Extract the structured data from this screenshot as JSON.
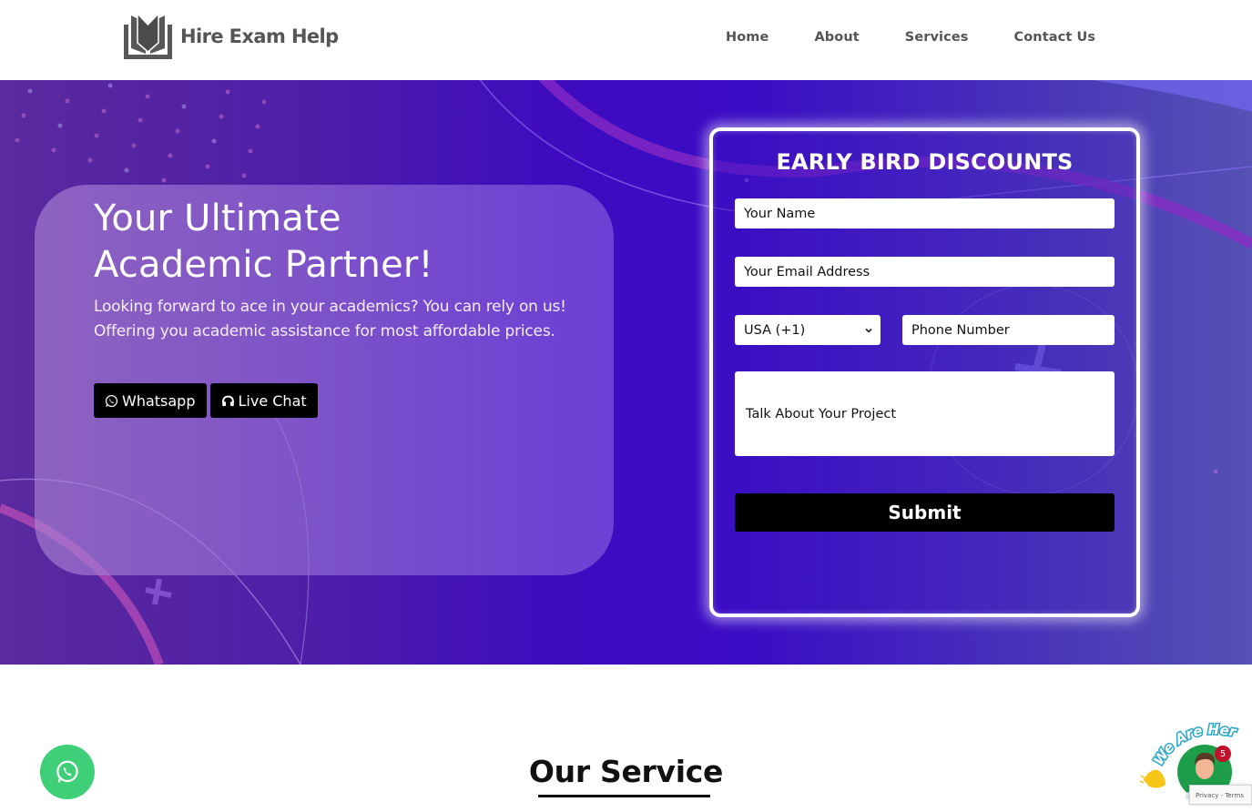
{
  "header": {
    "logo_text": "Hire Exam Help",
    "nav": [
      {
        "label": "Home"
      },
      {
        "label": "About"
      },
      {
        "label": "Services"
      },
      {
        "label": "Contact Us"
      }
    ]
  },
  "hero": {
    "title_line1": "Your Ultimate",
    "title_line2": "Academic Partner!",
    "description": "Looking forward to ace in your academics? You can rely on us! Offering you academic assistance for most affordable prices.",
    "buttons": [
      {
        "label": "Whatsapp",
        "icon": "whatsapp-icon"
      },
      {
        "label": "Live Chat",
        "icon": "headset-icon"
      }
    ]
  },
  "form": {
    "title": "EARLY BIRD DISCOUNTS",
    "name_placeholder": "Your Name",
    "email_placeholder": "Your Email Address",
    "country_selected": "USA (+1)",
    "phone_placeholder": "Phone Number",
    "project_placeholder": "Talk About Your Project",
    "submit_label": "Submit"
  },
  "services": {
    "title": "Our Service"
  },
  "widgets": {
    "chat_banner": "We Are Here!",
    "chat_badge_count": "5",
    "recaptcha_text": "Privacy - Terms"
  },
  "colors": {
    "hero_purple": "#3e0bbf",
    "whatsapp_green": "#3fcf79",
    "badge_red": "#c0102a"
  }
}
